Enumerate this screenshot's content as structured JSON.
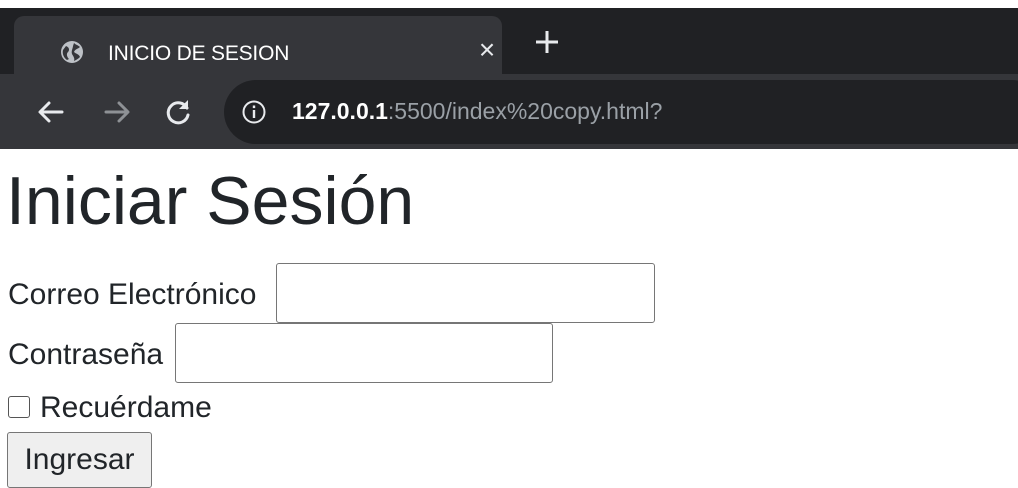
{
  "browser": {
    "tab": {
      "title": "INICIO DE SESION",
      "close_glyph": "×",
      "favicon": "globe-icon"
    },
    "new_tab_icon": "plus-icon",
    "nav": {
      "back_icon": "arrow-left-icon",
      "forward_icon": "arrow-right-icon",
      "reload_icon": "reload-icon"
    },
    "address": {
      "info_icon": "info-icon",
      "host": "127.0.0.1",
      "rest": ":5500/index%20copy.html?"
    },
    "colors": {
      "tab_strip": "#202124",
      "toolbar": "#35363a",
      "omnibox": "#202124"
    }
  },
  "page": {
    "title": "Iniciar Sesión",
    "email": {
      "label": "Correo Electrónico",
      "value": "",
      "placeholder": ""
    },
    "password": {
      "label": "Contraseña",
      "value": "",
      "placeholder": ""
    },
    "remember": {
      "label": "Recuérdame",
      "checked": false
    },
    "submit_label": "Ingresar"
  }
}
